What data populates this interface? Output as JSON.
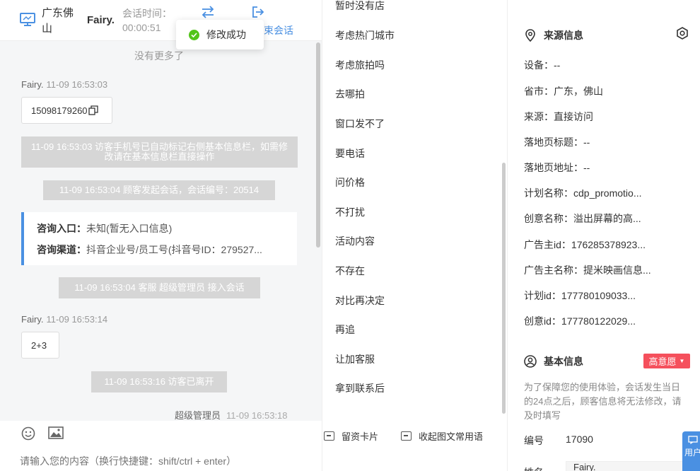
{
  "header": {
    "location": "广东佛山",
    "visitor_name": "Fairy.",
    "session_time_label": "会话时间：",
    "session_time_value": "00:00:51",
    "end_session_label": "结束会话",
    "end_session_visible": "束会话"
  },
  "toast": {
    "message": "修改成功"
  },
  "chat": {
    "no_more": "没有更多了",
    "messages": [
      {
        "sender": "Fairy.",
        "time": "11-09 16:53:03",
        "text": "15098179260"
      },
      {
        "sender": "Fairy.",
        "time": "11-09 16:53:14",
        "text": "2+3"
      }
    ],
    "system": [
      "11-09 16:53:03 访客手机号已自动标记右侧基本信息栏，如需修改请在基本信息栏直接操作",
      "11-09 16:53:04 顾客发起会话，会话编号：20514",
      "11-09 16:53:04 客服 超级管理员 接入会话",
      "11-09 16:53:16 访客已离开"
    ],
    "consult": {
      "entry_label": "咨询入口：",
      "entry_value": "未知(暂无入口信息)",
      "channel_label": "咨询渠道：",
      "channel_value": "抖音企业号/员工号(抖音号ID：279527..."
    },
    "agent": {
      "name": "超级管理员",
      "time": "11-09 16:53:18"
    },
    "input_placeholder": "请输入您的内容（换行快捷键：shift/ctrl + enter）"
  },
  "phrases": {
    "items": [
      "暂时没有店",
      "考虑热门城市",
      "考虑旅拍吗",
      "去哪拍",
      "窗口发不了",
      "要电话",
      "问价格",
      "不打扰",
      "活动内容",
      "不存在",
      "对比再决定",
      "再追",
      "让加客服",
      "拿到联系后"
    ],
    "card_button": "留资卡片",
    "collapse_button": "收起图文常用语"
  },
  "info": {
    "source_title": "来源信息",
    "source_fields": [
      {
        "label": "设备：",
        "value": "--"
      },
      {
        "label": "省市：",
        "value": "广东，佛山"
      },
      {
        "label": "来源：",
        "value": "直接访问"
      },
      {
        "label": "落地页标题：",
        "value": "--"
      },
      {
        "label": "落地页地址：",
        "value": "--"
      },
      {
        "label": "计划名称：",
        "value": "cdp_promotio..."
      },
      {
        "label": "创意名称：",
        "value": "溢出屏幕的高..."
      },
      {
        "label": "广告主id：",
        "value": "176285378923..."
      },
      {
        "label": "广告主名称：",
        "value": "提米映画信息..."
      },
      {
        "label": "计划id：",
        "value": "177780109033..."
      },
      {
        "label": "创意id：",
        "value": "177780122029..."
      }
    ],
    "basic_title": "基本信息",
    "intent_badge": "高意愿",
    "notice": "为了保障您的使用体验，会话发生当日的24点之后，顾客信息将无法修改，请及时填写",
    "id_label": "编号",
    "id_value": "17090",
    "name_label": "姓名",
    "name_value": "Fairy.",
    "float_label": "用户"
  },
  "colors": {
    "accent": "#4a90e2",
    "badge": "#f5505c",
    "success": "#52c41a"
  }
}
